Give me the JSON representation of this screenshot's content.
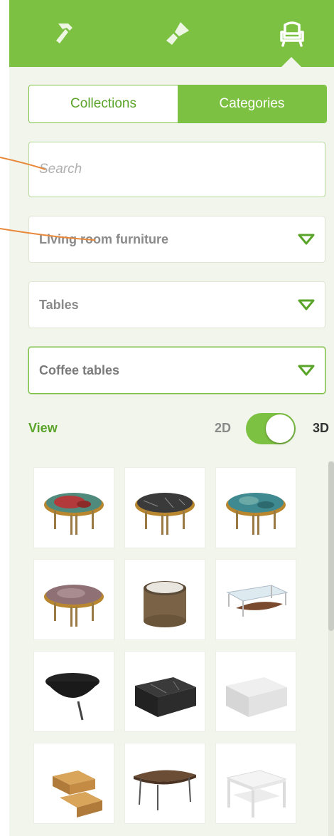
{
  "toolbar": {
    "icons": [
      "hammer-icon",
      "paint-brush-icon",
      "armchair-icon"
    ],
    "active_index": 2
  },
  "segmented": {
    "left_label": "Collections",
    "right_label": "Categories",
    "selected": "Categories"
  },
  "search": {
    "placeholder": "Search",
    "value": ""
  },
  "filters": {
    "room": "Living room furniture",
    "type": "Tables",
    "subtype": "Coffee tables"
  },
  "view": {
    "label": "View",
    "option_2d": "2D",
    "option_3d": "3D",
    "mode": "3D"
  },
  "products": [
    "red-marble-round-coffee-table",
    "black-marble-round-coffee-table",
    "teal-marble-round-coffee-table",
    "pink-marble-round-coffee-table",
    "bronze-drum-coffee-table",
    "glass-wood-coffee-table",
    "black-bowl-coffee-table",
    "black-marble-block-coffee-table",
    "white-marble-block-coffee-table",
    "wooden-stacked-coffee-table",
    "wooden-oval-coffee-table",
    "white-shelf-coffee-table"
  ],
  "colors": {
    "accent": "#7dc142",
    "accent_text": "#5aa42a",
    "panel_bg": "#f2f5ec",
    "annotation_line": "#e8883a"
  }
}
